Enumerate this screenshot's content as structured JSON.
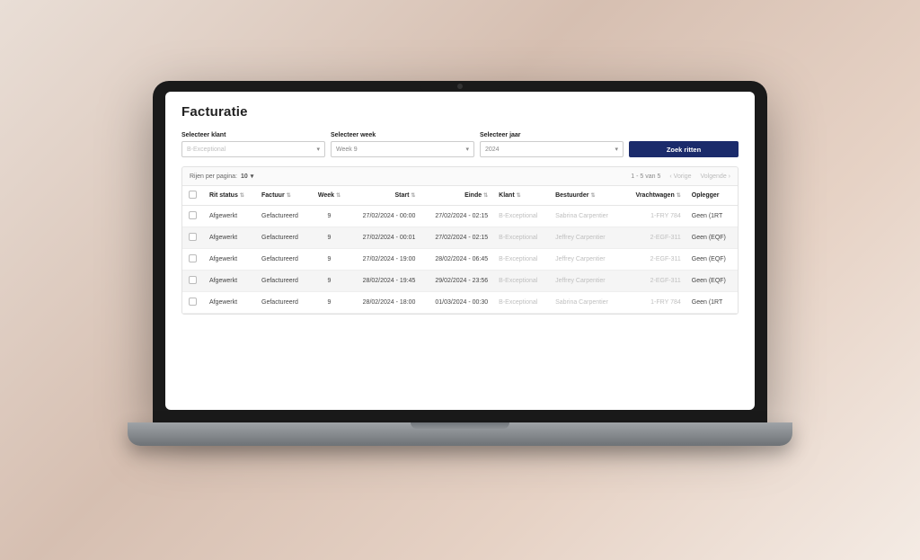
{
  "page": {
    "title": "Facturatie"
  },
  "filters": {
    "klant": {
      "label": "Selecteer klant",
      "value": "B-Exceptional"
    },
    "week": {
      "label": "Selecteer week",
      "value": "Week 9"
    },
    "jaar": {
      "label": "Selecteer jaar",
      "value": "2024"
    },
    "search_label": "Zoek ritten"
  },
  "table": {
    "rows_per_page_label": "Rijen per pagina:",
    "rows_per_page_value": "10",
    "range_text": "1 - 5 van 5",
    "prev_label": "Vorige",
    "next_label": "Volgende",
    "columns": {
      "rit_status": "Rit status",
      "factuur": "Factuur",
      "week": "Week",
      "start": "Start",
      "einde": "Einde",
      "klant": "Klant",
      "bestuurder": "Bestuurder",
      "vrachtwagen": "Vrachtwagen",
      "oplegger": "Oplegger"
    },
    "rows": [
      {
        "rit_status": "Afgewerkt",
        "factuur": "Gefactureerd",
        "week": "9",
        "start": "27/02/2024 - 00:00",
        "einde": "27/02/2024 - 02:15",
        "klant": "B-Exceptional",
        "bestuurder": "Sabrina Carpentier",
        "vrachtwagen": "1-FRY 784",
        "oplegger": "Geen (1RT"
      },
      {
        "rit_status": "Afgewerkt",
        "factuur": "Gefactureerd",
        "week": "9",
        "start": "27/02/2024 - 00:01",
        "einde": "27/02/2024 - 02:15",
        "klant": "B-Exceptional",
        "bestuurder": "Jeffrey Carpentier",
        "vrachtwagen": "2-EGF-311",
        "oplegger": "Geen (EQF)"
      },
      {
        "rit_status": "Afgewerkt",
        "factuur": "Gefactureerd",
        "week": "9",
        "start": "27/02/2024 - 19:00",
        "einde": "28/02/2024 - 06:45",
        "klant": "B-Exceptional",
        "bestuurder": "Jeffrey Carpentier",
        "vrachtwagen": "2-EGF-311",
        "oplegger": "Geen (EQF)"
      },
      {
        "rit_status": "Afgewerkt",
        "factuur": "Gefactureerd",
        "week": "9",
        "start": "28/02/2024 - 19:45",
        "einde": "29/02/2024 - 23:56",
        "klant": "B-Exceptional",
        "bestuurder": "Jeffrey Carpentier",
        "vrachtwagen": "2-EGF-311",
        "oplegger": "Geen (EQF)"
      },
      {
        "rit_status": "Afgewerkt",
        "factuur": "Gefactureerd",
        "week": "9",
        "start": "28/02/2024 - 18:00",
        "einde": "01/03/2024 - 00:30",
        "klant": "B-Exceptional",
        "bestuurder": "Sabrina Carpentier",
        "vrachtwagen": "1-FRY 784",
        "oplegger": "Geen (1RT"
      }
    ]
  },
  "colors": {
    "primary": "#1b2b6b"
  }
}
